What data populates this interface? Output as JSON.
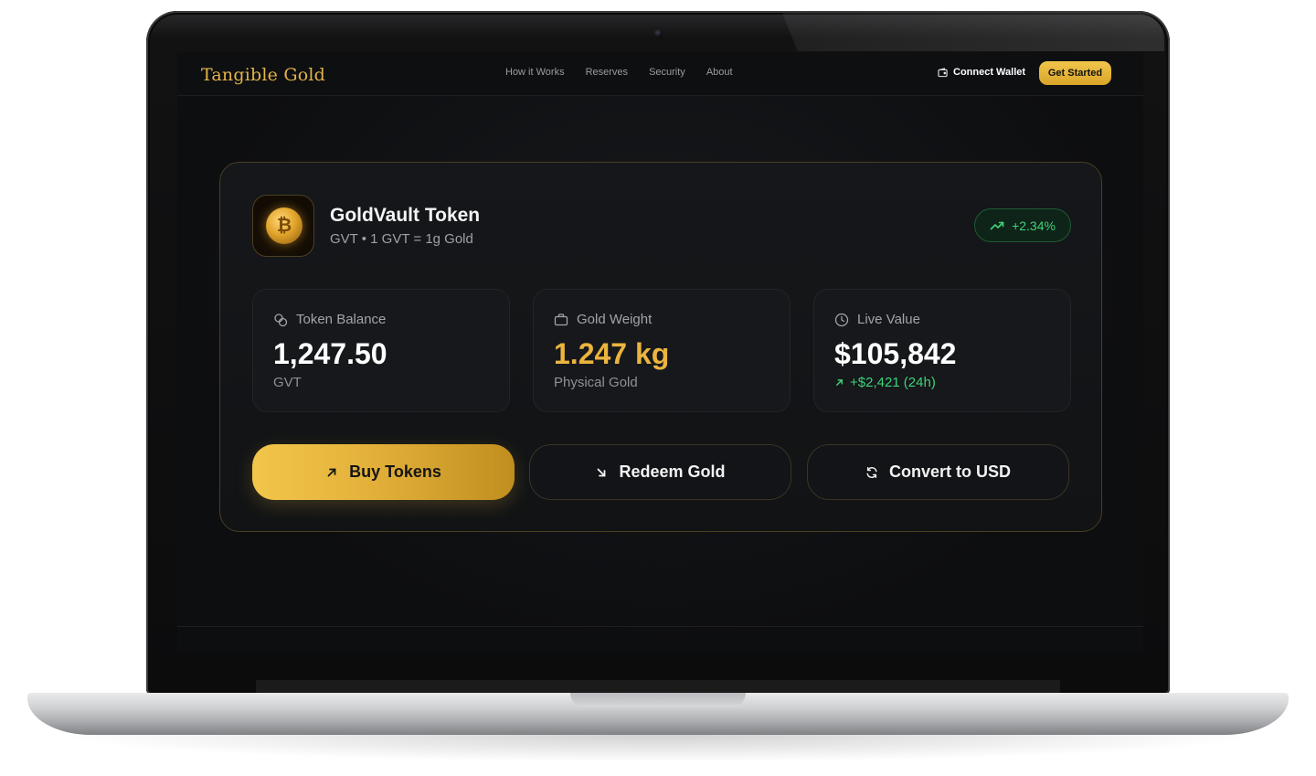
{
  "site": {
    "logo": "Tangible Gold",
    "nav_links": [
      "How it Works",
      "Reserves",
      "Security",
      "About"
    ],
    "connect_wallet": "Connect Wallet",
    "get_started": "Get Started"
  },
  "token": {
    "name": "GoldVault Token",
    "subtitle": "GVT • 1 GVT = 1g Gold",
    "icon": "bitcoin-coin-icon",
    "change": "+2.34%"
  },
  "stats": [
    {
      "label": "Token Balance",
      "icon": "coins-icon",
      "value": "1,247.50",
      "sub": "GVT"
    },
    {
      "label": "Gold Weight",
      "icon": "briefcase-icon",
      "value": "1.247 kg",
      "sub": "Physical Gold"
    },
    {
      "label": "Live Value",
      "icon": "clock-icon",
      "value": "$105,842",
      "sub": "+$2,421 (24h)"
    }
  ],
  "actions": {
    "buy": "Buy Tokens",
    "redeem": "Redeem Gold",
    "convert": "Convert to USD"
  },
  "colors": {
    "accent_gold": "#eab43e",
    "positive_green": "#3fd27a",
    "background": "#0d0e10"
  }
}
